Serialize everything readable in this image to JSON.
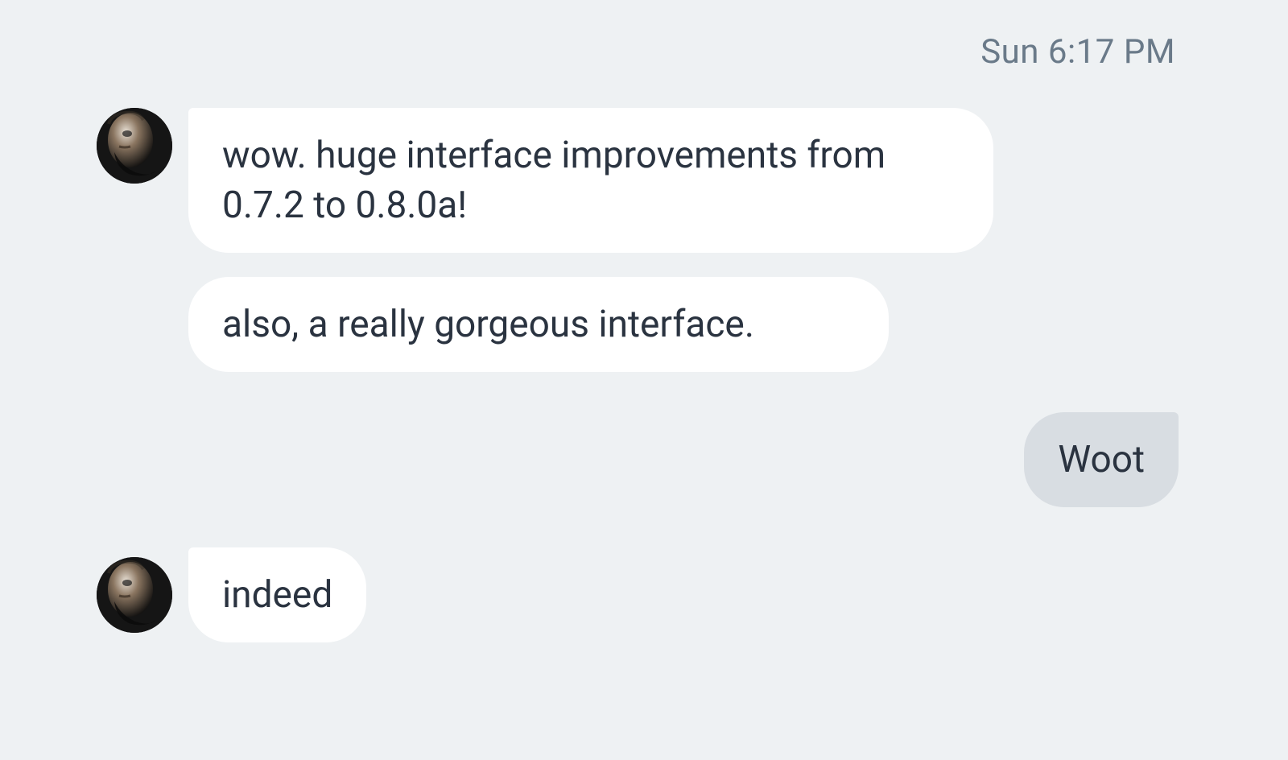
{
  "timestamp": "Sun 6:17 PM",
  "messages": {
    "group1": [
      "wow. huge interface improvements from 0.7.2 to 0.8.0a!",
      "also, a really gorgeous interface."
    ],
    "outgoing1": "Woot",
    "group2": [
      "indeed"
    ]
  },
  "colors": {
    "page_bg": "#eef1f3",
    "incoming_bubble": "#ffffff",
    "outgoing_bubble": "#d8dde2",
    "text": "#2a3340",
    "timestamp": "#6a7a89"
  }
}
